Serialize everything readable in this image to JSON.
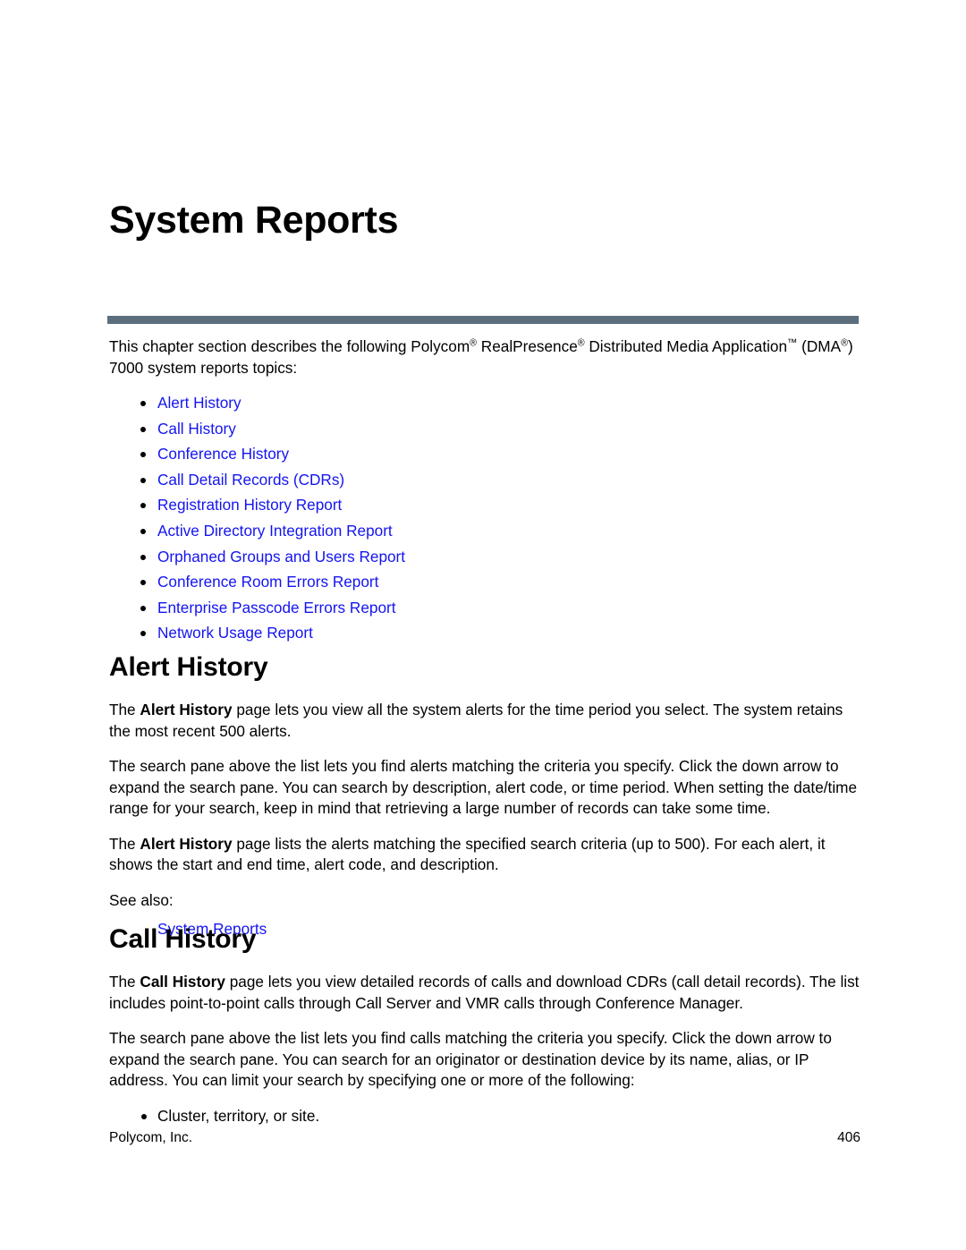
{
  "document": {
    "chapter_title": "System Reports",
    "footer": {
      "company": "Polycom, Inc.",
      "page_number": "406"
    },
    "accent_rule_color": "#5a6e7d",
    "link_color": "#1414f0"
  },
  "intro": {
    "line1_part1": "This chapter section describes the following Polycom",
    "reg1": "®",
    "line1_part2": " RealPresence",
    "reg2": "®",
    "line1_part3": " Distributed Media Application",
    "tm1": "™",
    "line2_part1": "(DMA",
    "reg3": "®",
    "line2_part2": ") 7000 system reports topics:",
    "topics": [
      {
        "label": "Alert History"
      },
      {
        "label": "Call History"
      },
      {
        "label": "Conference History"
      },
      {
        "label": "Call Detail Records (CDRs)"
      },
      {
        "label": "Registration History Report"
      },
      {
        "label": "Active Directory Integration Report"
      },
      {
        "label": "Orphaned Groups and Users Report"
      },
      {
        "label": "Conference Room Errors Report"
      },
      {
        "label": "Enterprise Passcode Errors Report"
      },
      {
        "label": "Network Usage Report"
      }
    ]
  },
  "alert_history": {
    "heading": "Alert History",
    "p1_pre": "The ",
    "p1_bold": "Alert History",
    "p1_post": " page lets you view all the system alerts for the time period you select. The system retains the most recent 500 alerts.",
    "p2": "The search pane above the list lets you find alerts matching the criteria you specify. Click the down arrow to expand the search pane. You can search by description, alert code, or time period. When setting the date/time range for your search, keep in mind that retrieving a large number of records can take some time.",
    "p3_pre": "The ",
    "p3_bold": "Alert History",
    "p3_post": " page lists the alerts matching the specified search criteria (up to 500). For each alert, it shows the start and end time, alert code, and description.",
    "see_also_label": "See also:",
    "see_also_link": "System Reports"
  },
  "call_history": {
    "heading": "Call History",
    "p1_pre": "The ",
    "p1_bold": "Call History",
    "p1_post": " page lets you view detailed records of calls and download CDRs (call detail records). The list includes point-to-point calls through Call Server and VMR calls through Conference Manager.",
    "p2": "The search pane above the list lets you find calls matching the criteria you specify. Click the down arrow to expand the search pane. You can search for an originator or destination device by its name, alias, or IP address. You can limit your search by specifying one or more of the following:",
    "bullets": [
      {
        "label": "Cluster, territory, or site."
      }
    ]
  }
}
